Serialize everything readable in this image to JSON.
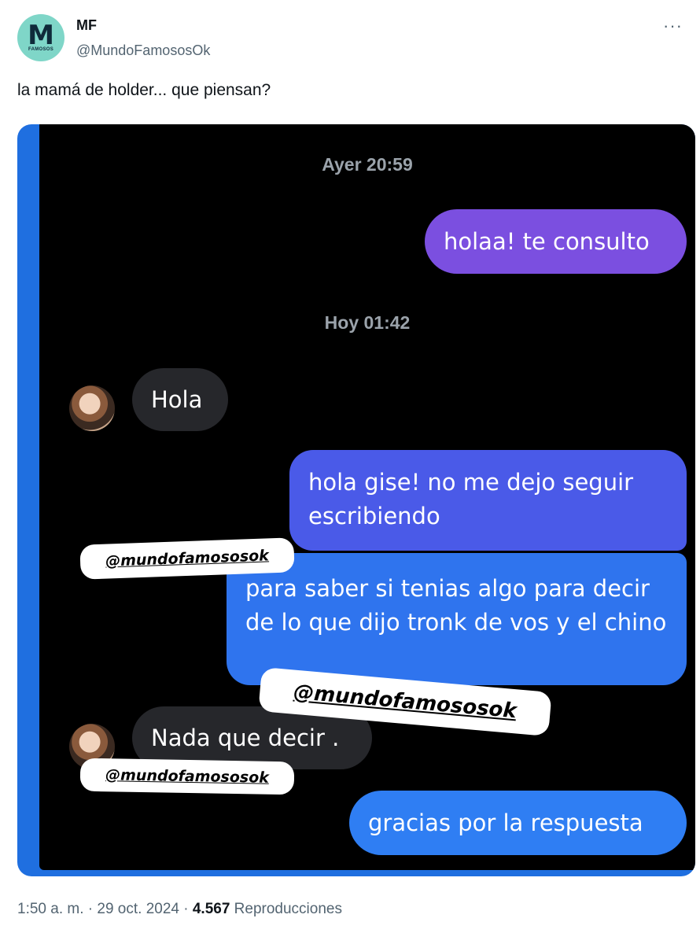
{
  "author": {
    "avatar_letter": "M",
    "avatar_sub": "FAMOSOS",
    "name": "MF",
    "handle": "@MundoFamososOk"
  },
  "more_label": "···",
  "tweet_text": "la mamá de holder... que piensan?",
  "chat": {
    "timestamp_1": "Ayer 20:59",
    "timestamp_2": "Hoy 01:42",
    "msg_out_1": "holaa! te consulto",
    "msg_in_1": "Hola",
    "msg_out_2": "hola gise! no me dejo seguir escribiendo",
    "msg_out_3": "para saber si tenias algo para decir de lo que dijo tronk de vos y el chino",
    "msg_in_2": "Nada que decir .",
    "msg_out_4": "gracias por la respuesta",
    "watermark": "@mundofamososok"
  },
  "footer": {
    "time_date": "1:50 a. m. · 29 oct. 2024 · ",
    "views_count": "4.567",
    "views_label": " Reproducciones"
  }
}
